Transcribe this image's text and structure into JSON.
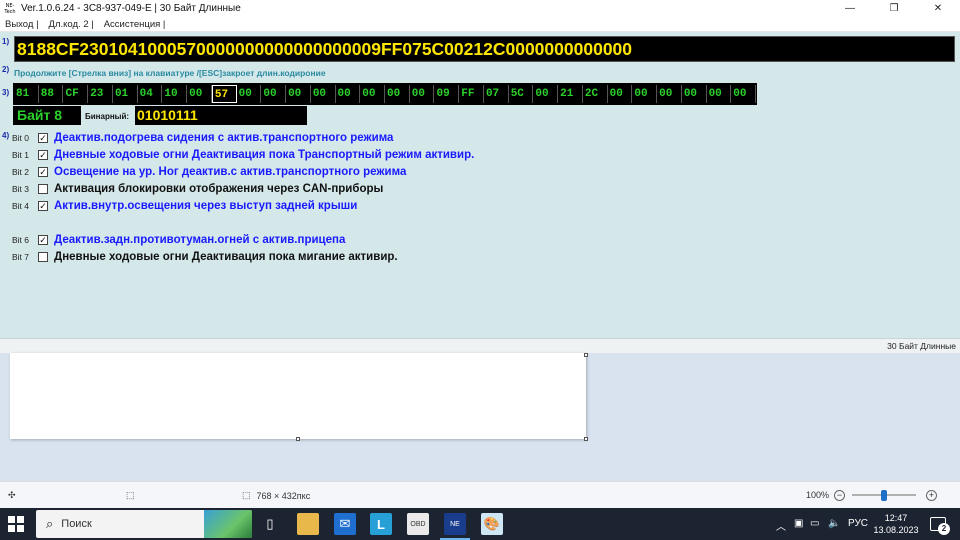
{
  "window": {
    "app_icon_text": "NE-Tech",
    "title": "Ver.1.0.6.24 -   3C8-937-049-E | 30 Байт Длинные",
    "minimize": "—",
    "maximize": "❐",
    "close": "✕"
  },
  "menu": [
    "Выход |",
    "Дл.код. 2 |",
    "Ассистенция |"
  ],
  "steps": {
    "s1": "1)",
    "s2": "2)",
    "s3": "3)",
    "s4": "4)"
  },
  "coding_string": "8188CF2301041000570000000000000000009FF075C00212C0000000000000",
  "hint": "Продолжите [Стрелка вниз] на клавиатуре /[ESC]закроет длин.кодироние",
  "bytes": [
    "81",
    "88",
    "CF",
    "23",
    "01",
    "04",
    "10",
    "00",
    "57",
    "00",
    "00",
    "00",
    "00",
    "00",
    "00",
    "00",
    "00",
    "09",
    "FF",
    "07",
    "5C",
    "00",
    "21",
    "2C",
    "00",
    "00",
    "00",
    "00",
    "00",
    "00"
  ],
  "selected_byte_index": 8,
  "byte_label": "Байт 8",
  "binary_label": "Бинарный:",
  "binary_value": "01010111",
  "bits": [
    {
      "name": "Bit 0",
      "checked": true,
      "text": "Деактив.подогрева сидения с актив.транспортного режима"
    },
    {
      "name": "Bit 1",
      "checked": true,
      "text": "Дневные ходовые огни Деактивация пока Транспортный режим активир."
    },
    {
      "name": "Bit 2",
      "checked": true,
      "text": "Освещение на ур. Ног деактив.с актив.транспортного режима"
    },
    {
      "name": "Bit 3",
      "checked": false,
      "text": "Активация блокировки отображения через  CAN-приборы"
    },
    {
      "name": "Bit 4",
      "checked": true,
      "text": "Актив.внутр.освещения через выступ задней крыши"
    },
    {
      "name": "Bit 6",
      "checked": true,
      "text": "Деактив.задн.противотуман.огней с актив.прицепа"
    },
    {
      "name": "Bit 7",
      "checked": false,
      "text": "Дневные ходовые огни Деактивация пока мигание активир."
    }
  ],
  "status_right": "30 Байт Длинные",
  "paint": {
    "move_icon": "✣",
    "select_icon": "⬚",
    "size_icon": "⬚",
    "image_size": "768 × 432пкс",
    "zoom": "100%",
    "zoom_out": "−",
    "zoom_in": "+"
  },
  "taskbar": {
    "search_placeholder": "Поиск",
    "search_icon": "⌕",
    "tray_chevron": "︿",
    "language": "РУС",
    "time": "12:47",
    "date": "13.08.2023",
    "notifications": "2"
  }
}
